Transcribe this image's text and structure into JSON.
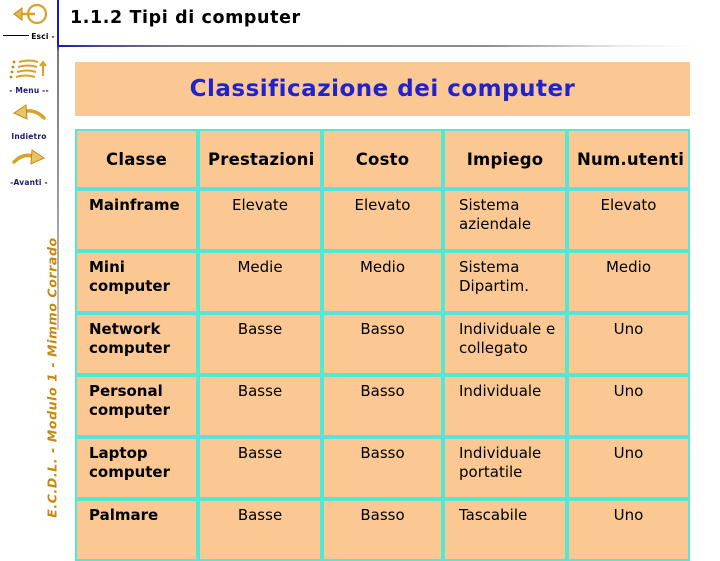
{
  "header": {
    "title": "1.1.2 Tipi di computer"
  },
  "nav": {
    "items": [
      {
        "label": "Esci -",
        "icon": "exit-arrow-icon",
        "name": "esci"
      },
      {
        "label": "- Menu --",
        "icon": "menu-list-icon",
        "name": "menu"
      },
      {
        "label": "Indietro",
        "icon": "back-arrow-icon",
        "name": "indietro"
      },
      {
        "label": "-Avanti -",
        "icon": "forward-arrow-icon",
        "name": "avanti"
      }
    ]
  },
  "credit": {
    "text": "E.C.D.L. - Modulo 1 - Mimmo Corrado"
  },
  "banner": {
    "title": "Classificazione dei computer",
    "background_color": "#fbc893",
    "text_color": "#2222cc"
  },
  "table": {
    "border_color": "#55e6d8",
    "cell_background": "#fbc893",
    "columns": [
      "Classe",
      "Prestazioni",
      "Costo",
      "Impiego",
      "Num.utenti"
    ],
    "rows": [
      {
        "classe": "Mainframe",
        "prestazioni": "Elevate",
        "costo": "Elevato",
        "impiego": "Sistema aziendale",
        "num_utenti": "Elevato"
      },
      {
        "classe": "Mini computer",
        "prestazioni": "Medie",
        "costo": "Medio",
        "impiego": "Sistema Dipartim.",
        "num_utenti": "Medio"
      },
      {
        "classe": "Network computer",
        "prestazioni": "Basse",
        "costo": "Basso",
        "impiego": "Individuale e collegato",
        "num_utenti": "Uno"
      },
      {
        "classe": "Personal computer",
        "prestazioni": "Basse",
        "costo": "Basso",
        "impiego": "Individuale",
        "num_utenti": "Uno"
      },
      {
        "classe": "Laptop computer",
        "prestazioni": "Basse",
        "costo": "Basso",
        "impiego": "Individuale portatile",
        "num_utenti": "Uno"
      },
      {
        "classe": "Palmare",
        "prestazioni": "Basse",
        "costo": "Basso",
        "impiego": "Tascabile",
        "num_utenti": "Uno"
      }
    ]
  }
}
